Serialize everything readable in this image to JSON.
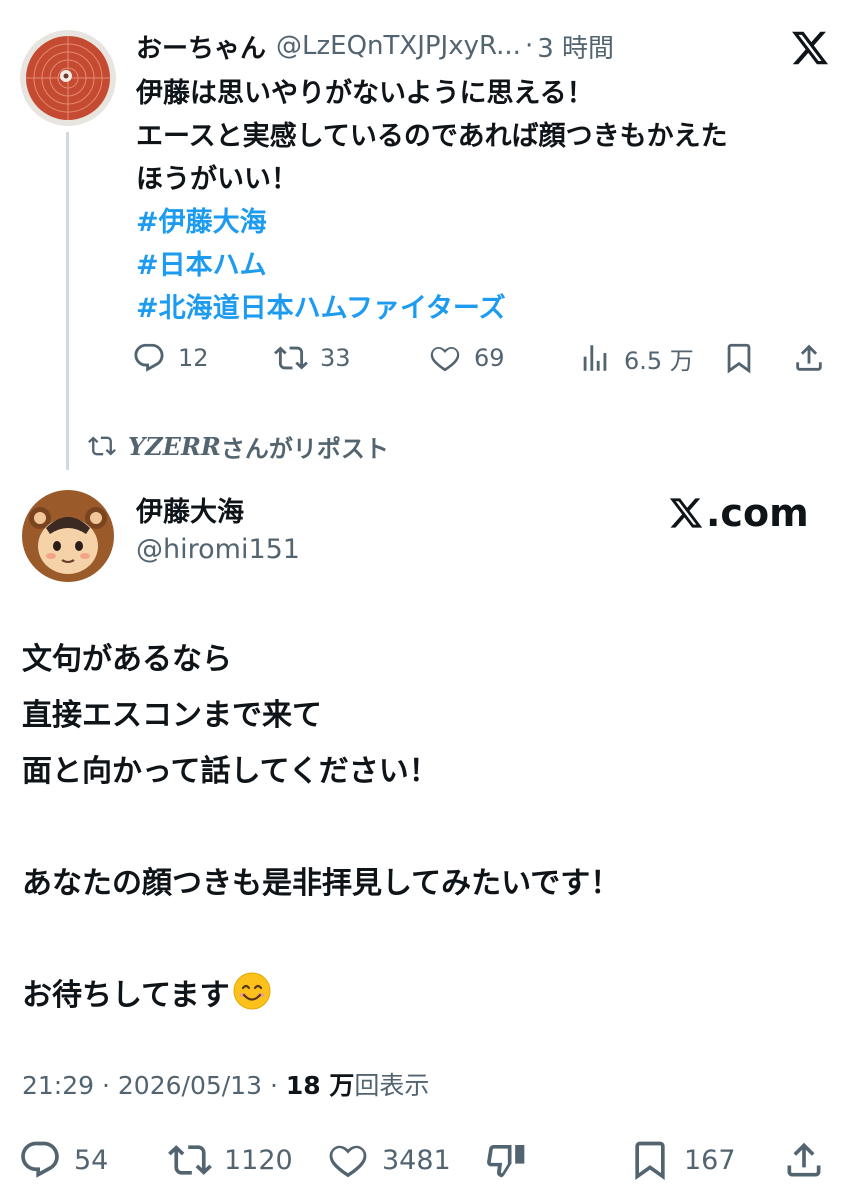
{
  "parent_tweet": {
    "display_name": "おーちゃん",
    "handle": "@LzEQnTXJPJxyR...",
    "separator": "·",
    "time": "3 時間",
    "text_lines": [
      "伊藤は思いやりがないように思える！",
      "エースと実感しているのであれば顔つきもかえた",
      "ほうがいい！"
    ],
    "hashtags": [
      "#伊藤大海",
      "#日本ハム",
      "#北海道日本ハムファイターズ"
    ],
    "actions": {
      "replies": "12",
      "reposts": "33",
      "likes": "69",
      "views": "6.5 万"
    }
  },
  "repost_label": {
    "user": "YZERR",
    "suffix": "さんがリポスト"
  },
  "main_tweet": {
    "display_name": "伊藤大海",
    "handle": "@hiromi151",
    "source_label": ".com",
    "text_lines": [
      "文句があるなら",
      "直接エスコンまで来て",
      "面と向かって話してください！",
      "",
      "あなたの顔つきも是非拝見してみたいです！",
      "",
      "お待ちしてます"
    ],
    "emoji": "smiling-face",
    "time": "21:29",
    "sep": "·",
    "date": "2026/05/13",
    "views_count": "18 万",
    "views_label": "回表示",
    "actions": {
      "replies": "54",
      "reposts": "1120",
      "likes": "3481",
      "bookmarks": "167"
    }
  },
  "colors": {
    "text": "#0f1419",
    "secondary": "#536471",
    "hashtag": "#1d9bf0",
    "thread_line": "#cfd9de"
  },
  "icons": [
    "x-logo-icon",
    "reply-icon",
    "repost-icon",
    "like-icon",
    "views-icon",
    "bookmark-icon",
    "share-icon",
    "dislike-icon"
  ]
}
